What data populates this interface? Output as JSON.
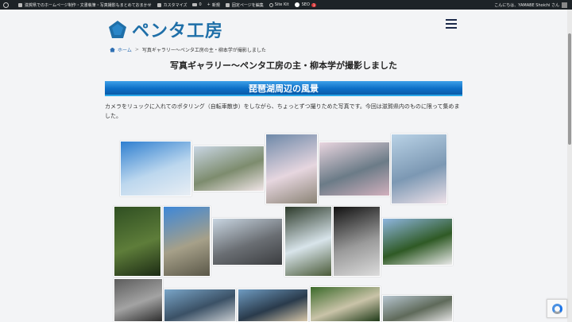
{
  "admin_bar": {
    "site_title": "滋賀県でのホームページ制作・文書執筆・写真撮影もまとめておまかせ",
    "customize": "カスタマイズ",
    "comments_count": "0",
    "new_label": "新規",
    "edit_label": "固定ページを編集",
    "sitekit_label": "Site Kit",
    "seo_label": "SEO",
    "seo_badge": "1",
    "greeting": "こんにちは、YAMABE Shoichi さん"
  },
  "site": {
    "logo_text": "ペンタ工房",
    "logo_color": "#1f6fa8"
  },
  "breadcrumb": {
    "home": "ホーム",
    "separator": ">",
    "current": "写真ギャラリー〜ペンタ工房の主・柳本学が撮影しました"
  },
  "page": {
    "title": "写真ギャラリー〜ペンタ工房の主・柳本学が撮影しました",
    "section_heading": "琵琶湖周辺の風景",
    "intro": "カメラをリュックに入れてのポタリング（自転車散歩）をしながら、ちょっとずつ撮りためた写真です。今回は滋賀県内のものに限って集めました。"
  },
  "gallery": {
    "photos": [
      {
        "name": "cherry-blossoms-lake-photo",
        "colors": [
          "#2f7fd0",
          "#bcd7ee",
          "#e8eef4"
        ]
      },
      {
        "name": "mountain-valley-cherry-photo",
        "colors": [
          "#c9d6e4",
          "#7d8c6e",
          "#f1e6e8"
        ]
      },
      {
        "name": "cherry-tree-mountain-photo",
        "colors": [
          "#6d88a8",
          "#e6d6df",
          "#8a8375"
        ]
      },
      {
        "name": "cherry-blossoms-hillside-photo",
        "colors": [
          "#e9d5df",
          "#6b7b87",
          "#d2b0bd"
        ]
      },
      {
        "name": "lake-view-cherry-photo",
        "colors": [
          "#b9d2e6",
          "#7c98b3",
          "#efe2e9"
        ]
      },
      {
        "name": "mossy-garden-photo",
        "colors": [
          "#2f4f22",
          "#5e7d3a",
          "#1c2b14"
        ]
      },
      {
        "name": "stone-pagoda-photo",
        "colors": [
          "#3d87d8",
          "#a6a089",
          "#5a5748"
        ]
      },
      {
        "name": "wooden-pier-photo",
        "colors": [
          "#c9d6e2",
          "#6a6e73",
          "#3b3d40"
        ]
      },
      {
        "name": "waterfall-photo",
        "colors": [
          "#2c3a2a",
          "#d8e4ea",
          "#4a5a38"
        ]
      },
      {
        "name": "lake-pavilion-mono-photo",
        "colors": [
          "#111111",
          "#9a9a9a",
          "#dcdcdc"
        ]
      },
      {
        "name": "castle-forest-photo",
        "colors": [
          "#8fb6df",
          "#2f5a25",
          "#e9e9e9"
        ]
      },
      {
        "name": "stone-buddha-photo",
        "colors": [
          "#5c5c5c",
          "#a3a3a3",
          "#2e2e2e"
        ]
      },
      {
        "name": "harbor-boats-photo",
        "colors": [
          "#7aa6c9",
          "#3b5166",
          "#c7ccd0"
        ]
      },
      {
        "name": "lakeside-posts-photo",
        "colors": [
          "#6f9cc2",
          "#2a3b4c",
          "#d6c6a8"
        ]
      },
      {
        "name": "temple-forest-photo",
        "colors": [
          "#3b6a2a",
          "#c9c3a8",
          "#1f3a18"
        ]
      },
      {
        "name": "bridge-ruins-photo",
        "colors": [
          "#b7c6d1",
          "#5f6a5a",
          "#e4e4e4"
        ]
      }
    ]
  },
  "recaptcha": {
    "label": "reCAPTCHA"
  }
}
